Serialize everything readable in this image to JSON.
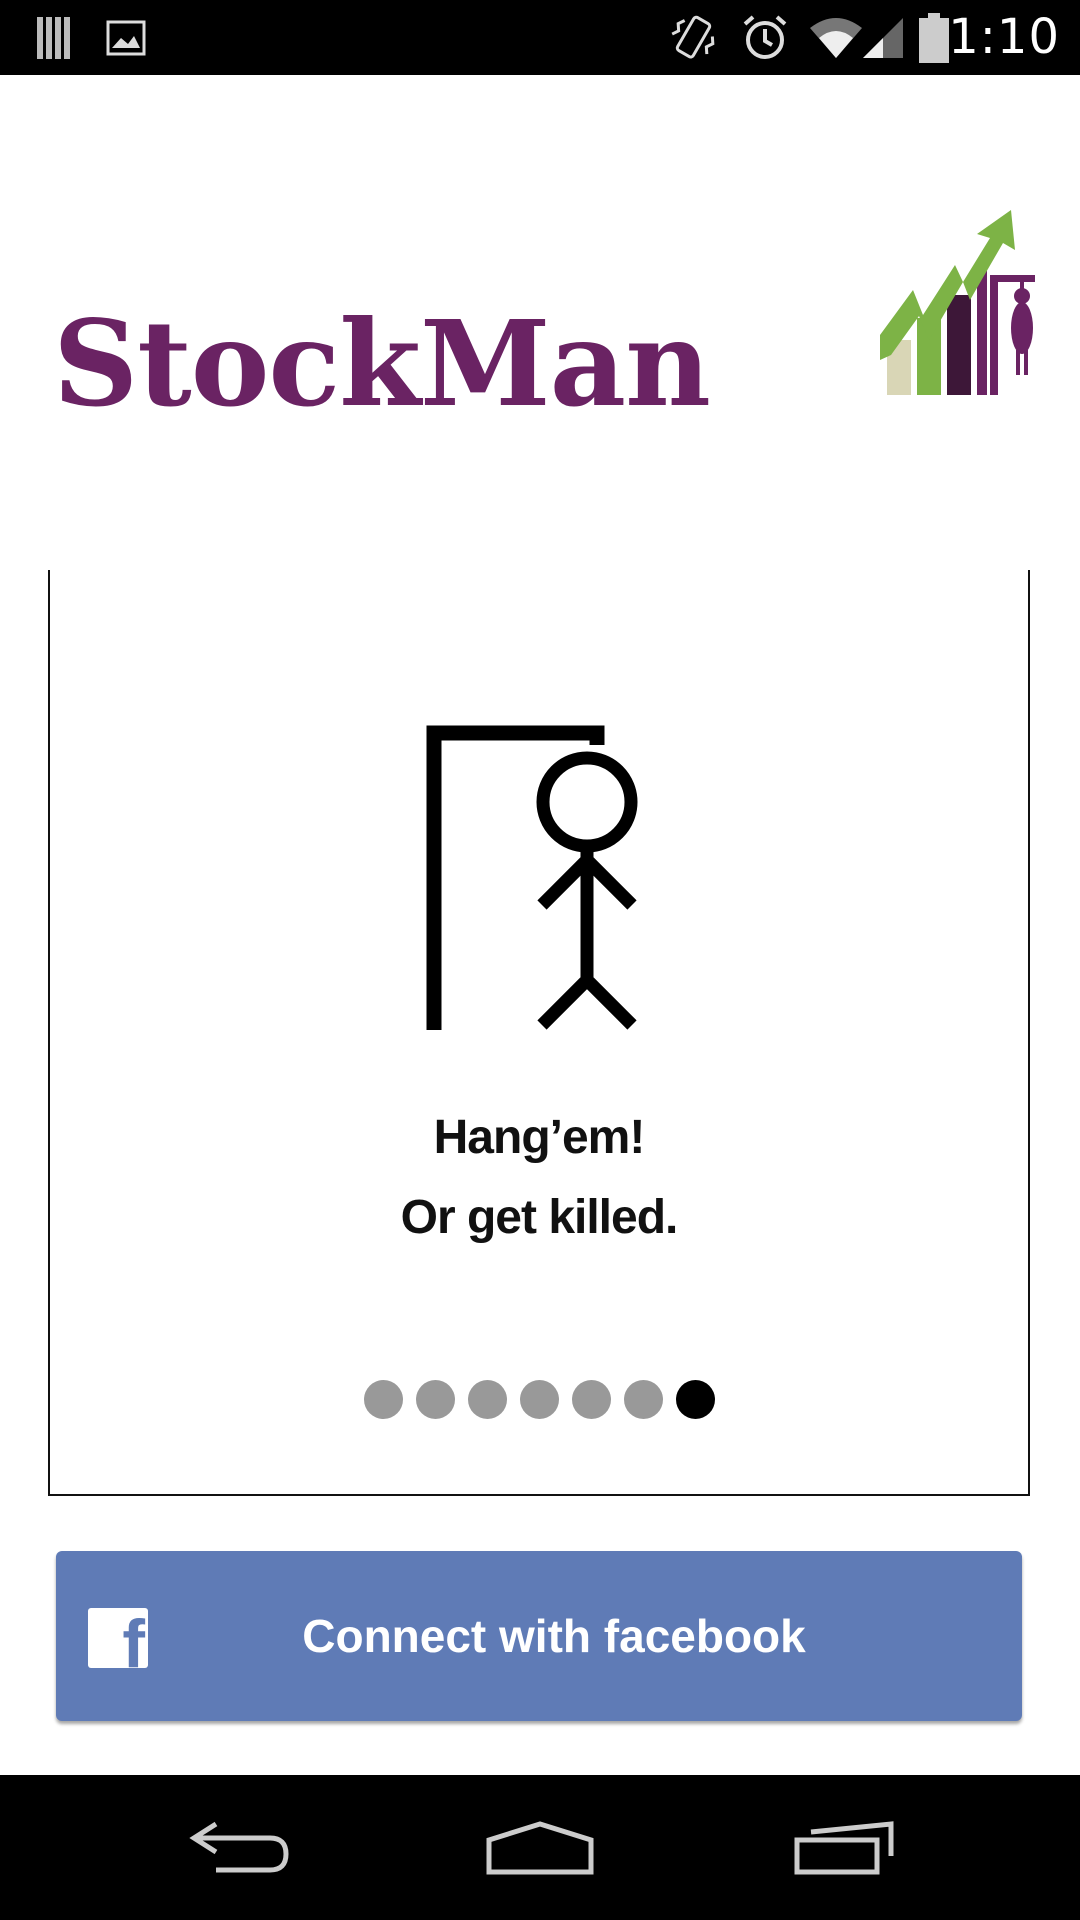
{
  "status_bar": {
    "time": "1:10",
    "icons": [
      "barcode-notification-icon",
      "image-notification-icon",
      "vibrate-icon",
      "alarm-icon",
      "wifi-icon",
      "cell-signal-icon",
      "battery-icon"
    ]
  },
  "logo": {
    "text": "StockMan",
    "brand_color": "#6a2363",
    "chart_green": "#7db346"
  },
  "onboarding": {
    "illustration": "hangman-icon",
    "line1": "Hang’em!",
    "line2": "Or get killed.",
    "page_count": 7,
    "active_page": 7
  },
  "facebook_button": {
    "label": "Connect with facebook",
    "icon": "facebook-icon",
    "color": "#5f7bb6"
  },
  "nav_bar": {
    "back": "back-icon",
    "home": "home-icon",
    "recents": "recents-icon"
  }
}
